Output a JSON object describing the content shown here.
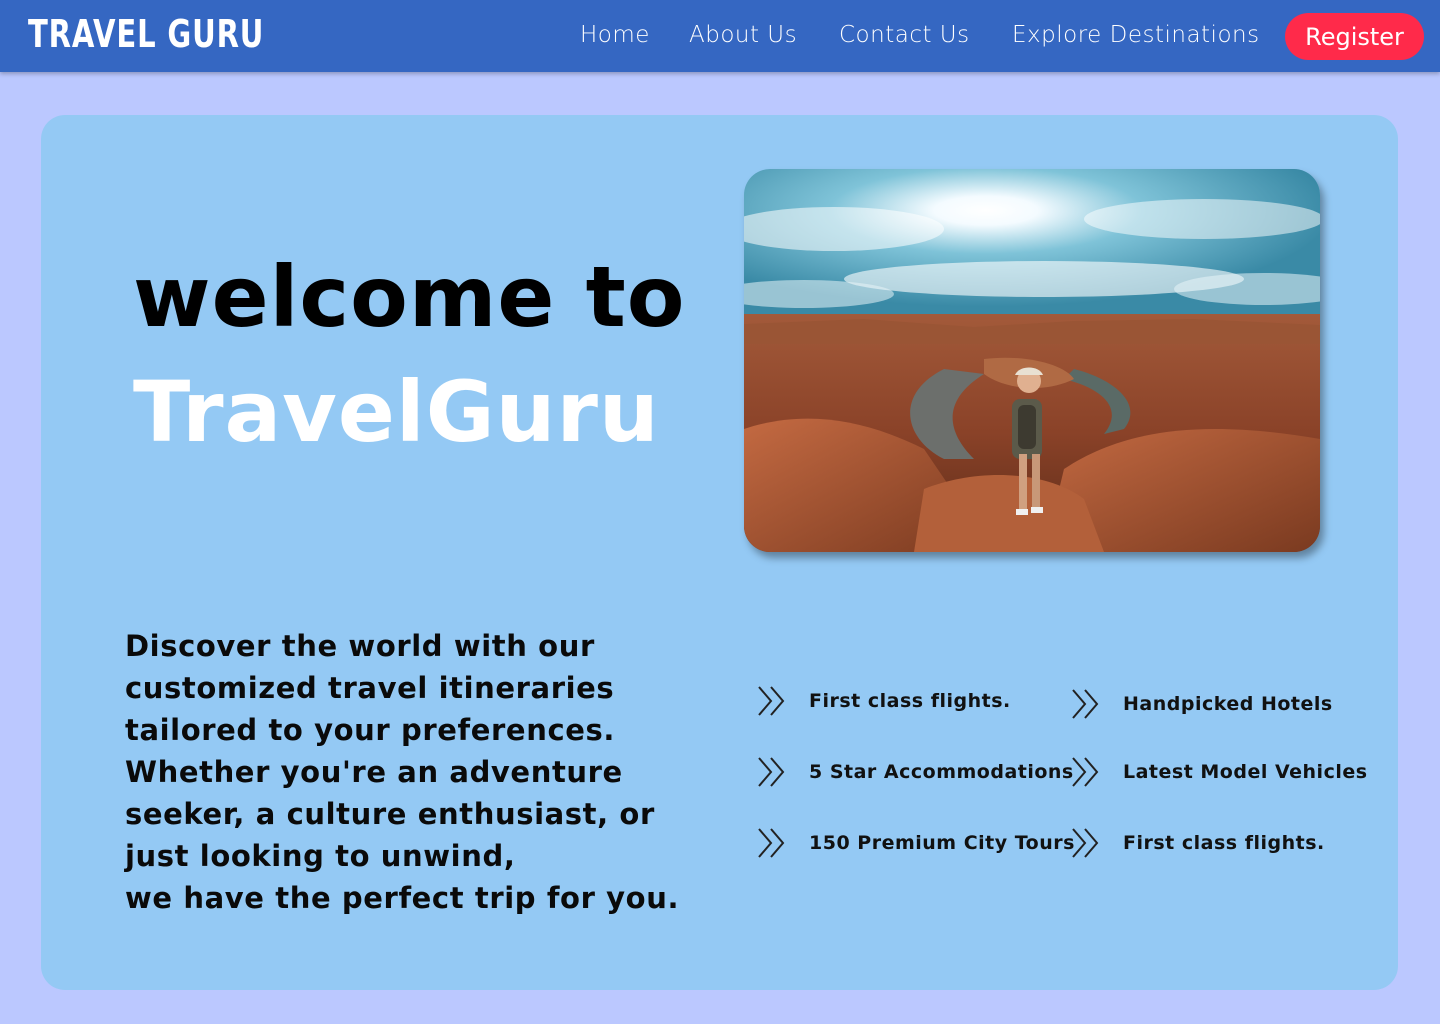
{
  "navbar": {
    "logo": "TRAVEL GURU",
    "links": [
      "Home",
      "About Us",
      "Contact Us",
      "Explore Destinations"
    ],
    "register": "Register"
  },
  "hero": {
    "line1": "welcome to",
    "line2": "TravelGuru",
    "description": [
      "Discover the world with our",
      "customized travel itineraries",
      "tailored to your preferences.",
      "Whether you're an adventure",
      "seeker, a culture enthusiast, or",
      "just looking to unwind,",
      "we have the perfect trip for you."
    ]
  },
  "features": [
    "First class flights.",
    "Handpicked Hotels",
    "5 Star Accommodations",
    "Latest Model Vehicles",
    "150 Premium City Tours",
    "First class flights."
  ],
  "colors": {
    "page_bg": "#bbc8ff",
    "navbar": "#3567c2",
    "card": "#94c9f4",
    "register": "#ff2a4a"
  },
  "icons": {
    "feature_bullet": "double-chevron-right-icon"
  }
}
